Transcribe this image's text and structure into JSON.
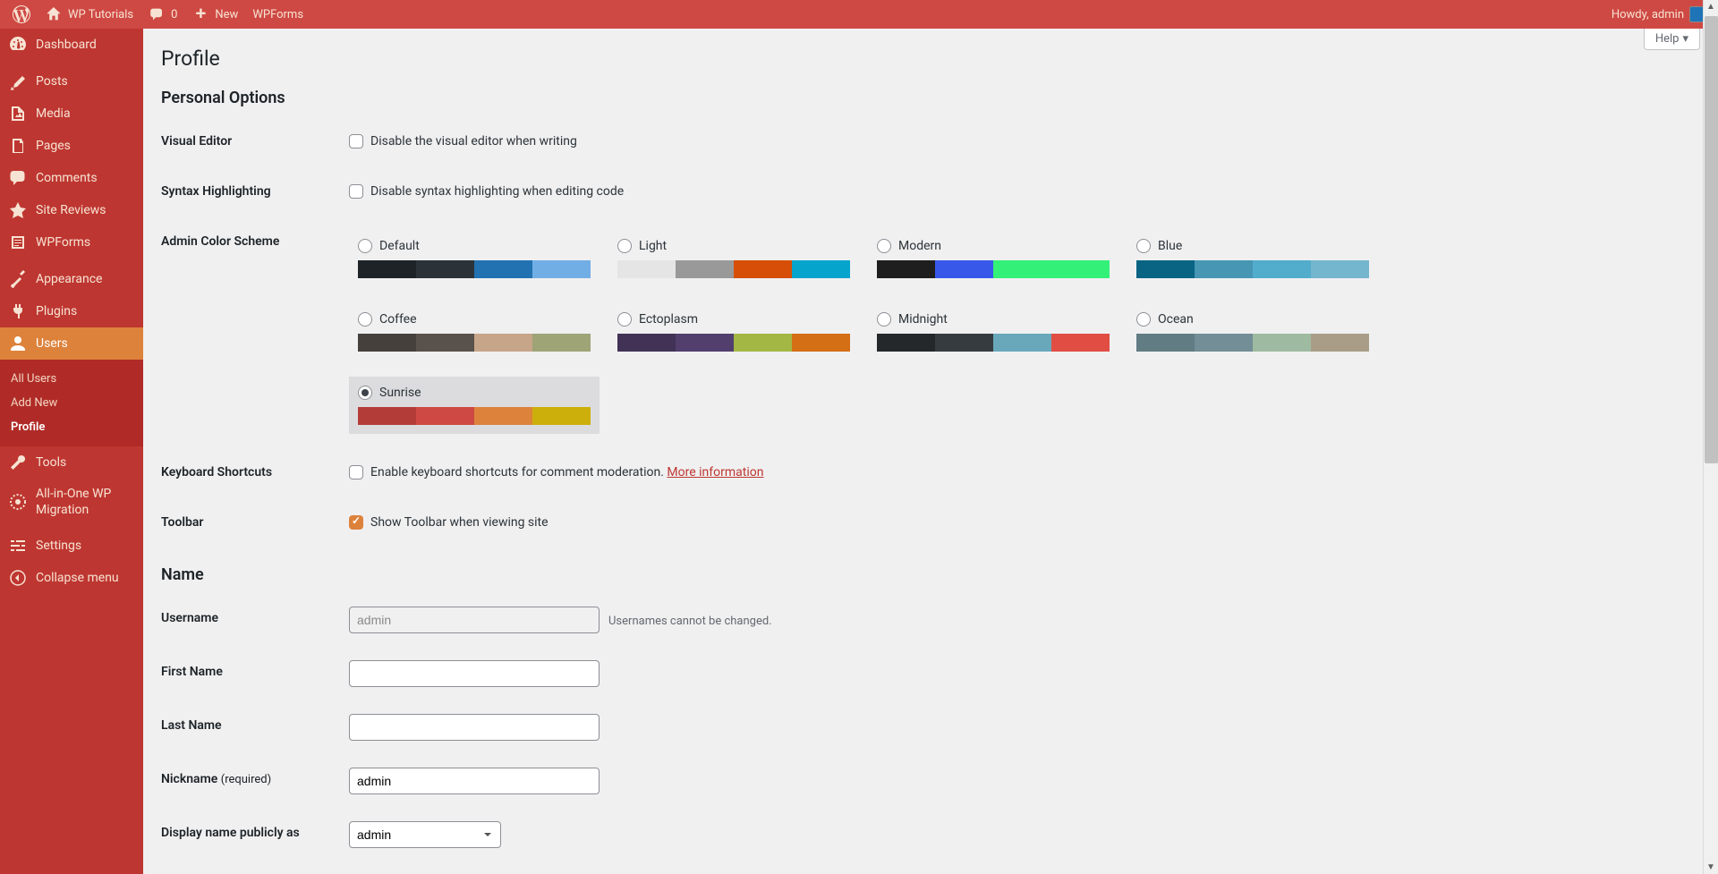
{
  "adminbar": {
    "site_name": "WP Tutorials",
    "comments_count": "0",
    "new_label": "New",
    "wpforms_label": "WPForms",
    "howdy": "Howdy, admin"
  },
  "sidebar": {
    "items": [
      {
        "label": "Dashboard"
      },
      {
        "label": "Posts"
      },
      {
        "label": "Media"
      },
      {
        "label": "Pages"
      },
      {
        "label": "Comments"
      },
      {
        "label": "Site Reviews"
      },
      {
        "label": "WPForms"
      },
      {
        "label": "Appearance"
      },
      {
        "label": "Plugins"
      },
      {
        "label": "Users"
      },
      {
        "label": "Tools"
      },
      {
        "label": "All-in-One WP Migration"
      },
      {
        "label": "Settings"
      },
      {
        "label": "Collapse menu"
      }
    ],
    "users_submenu": [
      {
        "label": "All Users"
      },
      {
        "label": "Add New"
      },
      {
        "label": "Profile"
      }
    ]
  },
  "help_label": "Help",
  "page_title": "Profile",
  "sections": {
    "personal_options": "Personal Options",
    "name": "Name"
  },
  "fields": {
    "visual_editor": {
      "label": "Visual Editor",
      "checkbox": "Disable the visual editor when writing"
    },
    "syntax": {
      "label": "Syntax Highlighting",
      "checkbox": "Disable syntax highlighting when editing code"
    },
    "color_scheme": {
      "label": "Admin Color Scheme"
    },
    "shortcuts": {
      "label": "Keyboard Shortcuts",
      "checkbox": "Enable keyboard shortcuts for comment moderation. ",
      "link": "More information"
    },
    "toolbar": {
      "label": "Toolbar",
      "checkbox": "Show Toolbar when viewing site"
    },
    "username": {
      "label": "Username",
      "value": "admin",
      "desc": "Usernames cannot be changed."
    },
    "first_name": {
      "label": "First Name",
      "value": ""
    },
    "last_name": {
      "label": "Last Name",
      "value": ""
    },
    "nickname": {
      "label": "Nickname ",
      "required": "(required)",
      "value": "admin"
    },
    "display_name": {
      "label": "Display name publicly as",
      "value": "admin"
    }
  },
  "color_schemes": [
    {
      "name": "Default",
      "colors": [
        "#1d2327",
        "#2c3338",
        "#2271b1",
        "#72aee6"
      ]
    },
    {
      "name": "Light",
      "colors": [
        "#e5e5e5",
        "#999999",
        "#d64e07",
        "#04a4cc"
      ]
    },
    {
      "name": "Modern",
      "colors": [
        "#1e1e1e",
        "#3858e9",
        "#33f078",
        "#33f078"
      ]
    },
    {
      "name": "Blue",
      "colors": [
        "#096484",
        "#4796b3",
        "#52accc",
        "#74B6CE"
      ]
    },
    {
      "name": "Coffee",
      "colors": [
        "#46403c",
        "#59524c",
        "#c7a589",
        "#9ea476"
      ]
    },
    {
      "name": "Ectoplasm",
      "colors": [
        "#413256",
        "#523f6d",
        "#a3b745",
        "#d46f15"
      ]
    },
    {
      "name": "Midnight",
      "colors": [
        "#25282b",
        "#363b3f",
        "#69a8bb",
        "#e14d43"
      ]
    },
    {
      "name": "Ocean",
      "colors": [
        "#627c83",
        "#738e96",
        "#9ebaa0",
        "#aa9d88"
      ]
    },
    {
      "name": "Sunrise",
      "colors": [
        "#b43c38",
        "#cf4944",
        "#dd823b",
        "#ccaf0b"
      ]
    }
  ]
}
